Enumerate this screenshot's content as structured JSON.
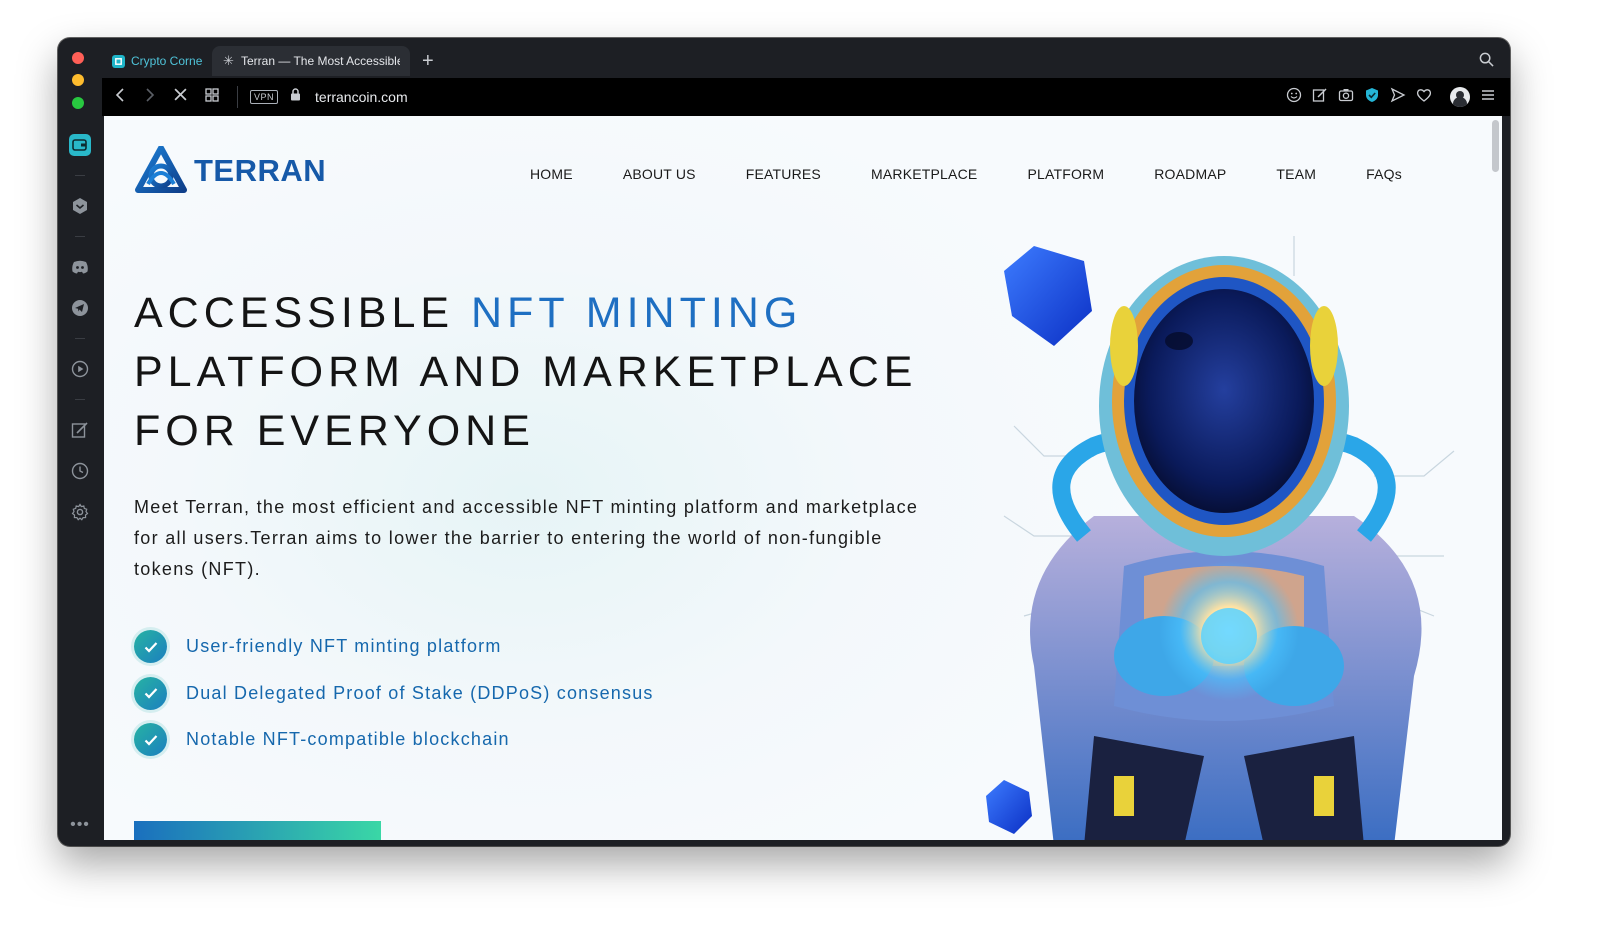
{
  "browser": {
    "tabs": [
      {
        "label": "Crypto Corne",
        "favicon": "crypto-corner-icon",
        "active": false
      },
      {
        "label": "Terran — The Most Accessible",
        "favicon": "loading-spinner-icon",
        "active": true
      }
    ],
    "url": "terrancoin.com",
    "vpn_label": "VPN"
  },
  "site": {
    "brand": "TERRAN",
    "brand_color": "#1659a8",
    "accent_color": "#1e6fc2",
    "nav": [
      "HOME",
      "ABOUT US",
      "FEATURES",
      "MARKETPLACE",
      "PLATFORM",
      "ROADMAP",
      "TEAM",
      "FAQs"
    ],
    "hero": {
      "title_line1_a": "ACCESSIBLE ",
      "title_line1_b": "NFT MINTING",
      "title_line2": "PLATFORM AND MARKETPLACE",
      "title_line3": "FOR EVERYONE",
      "description": "Meet Terran, the most efficient and accessible NFT minting platform and marketplace for all users.Terran aims to lower the barrier to entering the world of non-fungible tokens (NFT).",
      "features": [
        "User-friendly NFT minting platform",
        "Dual Delegated Proof of Stake (DDPoS) consensus",
        "Notable NFT-compatible blockchain"
      ]
    }
  }
}
